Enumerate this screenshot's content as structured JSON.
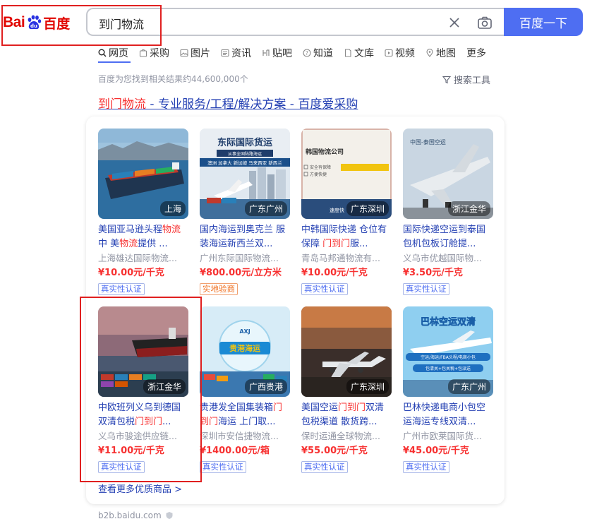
{
  "header": {
    "logo_bai": "Bai",
    "logo_du": "百度",
    "search_value": "到门物流",
    "search_button": "百度一下"
  },
  "tabs": [
    {
      "label": "网页",
      "icon": "search-icon",
      "active": true
    },
    {
      "label": "采购",
      "icon": "cart-icon"
    },
    {
      "label": "图片",
      "icon": "image-icon"
    },
    {
      "label": "资讯",
      "icon": "news-icon"
    },
    {
      "label": "贴吧",
      "icon": "tieba-icon"
    },
    {
      "label": "知道",
      "icon": "question-icon"
    },
    {
      "label": "文库",
      "icon": "document-icon"
    },
    {
      "label": "视频",
      "icon": "video-icon"
    },
    {
      "label": "地图",
      "icon": "map-icon"
    },
    {
      "label": "更多"
    }
  ],
  "results": {
    "count_text": "百度为您找到相关结果约44,600,000个",
    "search_tools": "搜索工具"
  },
  "result": {
    "title_highlight": "到门物流",
    "title_rest": " - 专业服务/工程/解决方案 - 百度爱采购",
    "more_link": "查看更多优质商品 >",
    "domain": "b2b.baidu.com"
  },
  "products": [
    {
      "location": "上海",
      "title_parts": [
        [
          "美国亚马逊头程",
          0
        ],
        [
          "物流",
          1
        ],
        [
          "中 美",
          0
        ],
        [
          "物流",
          1
        ],
        [
          "提供 ...",
          0
        ]
      ],
      "company": "上海雄达国际物流...",
      "price": "¥10.00元/千克",
      "badge": "真实性认证",
      "badge_style": "blue"
    },
    {
      "location": "广东广州",
      "title_parts": [
        [
          "国内海运到奥克兰 服装海运新西兰双...",
          0
        ]
      ],
      "company": "广州东际国际物流...",
      "price": "¥800.00元/立方米",
      "badge": "实地验商",
      "badge_style": "orange"
    },
    {
      "location": "广东深圳",
      "title_parts": [
        [
          "中韩国际快递 仓位有保障 ",
          0
        ],
        [
          "门到门",
          1
        ],
        [
          "服...",
          0
        ]
      ],
      "company": "青岛马邦通物流有...",
      "price": "¥10.00元/千克",
      "badge": "真实性认证",
      "badge_style": "blue"
    },
    {
      "location": "浙江金华",
      "title_parts": [
        [
          "国际快递空运到泰国包机包板订舱提...",
          0
        ]
      ],
      "company": "义乌市优越国际物...",
      "price": "¥3.50元/千克",
      "badge": "真实性认证",
      "badge_style": "blue"
    },
    {
      "location": "浙江金华",
      "title_parts": [
        [
          "中欧班列义乌到德国双清包税",
          0
        ],
        [
          "门到门",
          1
        ],
        [
          "...",
          0
        ]
      ],
      "company": "义乌市骏途供应链...",
      "price": "¥11.00元/千克",
      "badge": "真实性认证",
      "badge_style": "blue"
    },
    {
      "location": "广西贵港",
      "title_parts": [
        [
          "贵港发全国集装箱",
          0
        ],
        [
          "门到门",
          1
        ],
        [
          "海运 上门取...",
          0
        ]
      ],
      "company": "深圳市安信捷物流...",
      "price": "¥1400.00元/箱",
      "badge": "真实性认证",
      "badge_style": "blue"
    },
    {
      "location": "广东深圳",
      "title_parts": [
        [
          "美国空运",
          0
        ],
        [
          "门到门",
          1
        ],
        [
          "双清包税渠道 散货跨...",
          0
        ]
      ],
      "company": "保时运通全球物流...",
      "price": "¥55.00元/千克",
      "badge": "真实性认证",
      "badge_style": "blue"
    },
    {
      "location": "广东广州",
      "title_parts": [
        [
          "巴林快递电商小包空运海运专线双清...",
          0
        ]
      ],
      "company": "广州市欧莱国际货...",
      "price": "¥45.00元/千克",
      "badge": "真实性认证",
      "badge_style": "blue"
    }
  ],
  "images": {
    "p2_banner": "东际国际货运",
    "p2_sub": "从事全国陆路海运",
    "p2_strip": "澳洲 加拿大 新加坡 马来西亚 新西兰",
    "p3_banner": "韩国物流公司",
    "p3_line1": "安全有保障",
    "p3_line2": "方便快捷",
    "p3_foot": "速度快",
    "p4_top": "中国-泰国空运",
    "p6_logo": "AXJ",
    "p6_text": "贵港海运",
    "p8_banner": "巴林空运双清",
    "p8_sub": "空运/海运/FBA头程/电商小包",
    "p8_sub2": "包清关+包关税+包派送"
  },
  "colors": {
    "brand_red": "#e10601",
    "accent_blue": "#4e6ef2",
    "link_blue": "#2440b3",
    "price_red": "#f73131"
  }
}
